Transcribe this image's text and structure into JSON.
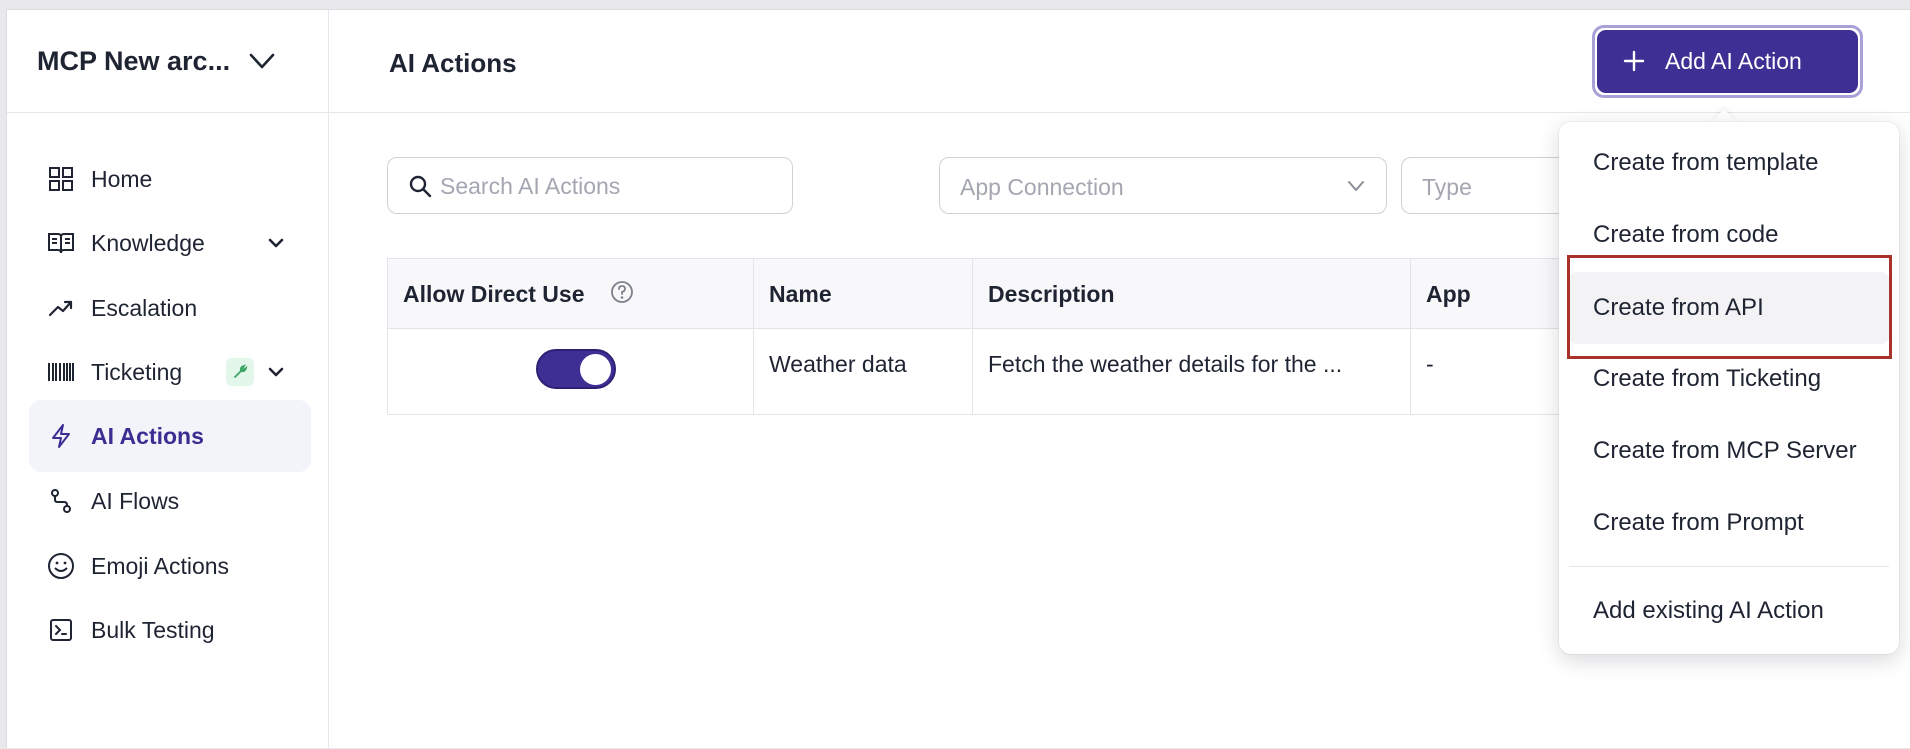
{
  "sidebar": {
    "workspace_name": "MCP New arc...",
    "items": [
      {
        "label": "Home",
        "icon": "grid-icon"
      },
      {
        "label": "Knowledge",
        "icon": "book-icon"
      },
      {
        "label": "Escalation",
        "icon": "trend-up-icon"
      },
      {
        "label": "Ticketing",
        "icon": "barcode-icon"
      },
      {
        "label": "AI Actions",
        "icon": "bolt-icon"
      },
      {
        "label": "AI Flows",
        "icon": "flow-icon"
      },
      {
        "label": "Emoji Actions",
        "icon": "smile-icon"
      },
      {
        "label": "Bulk Testing",
        "icon": "terminal-icon"
      }
    ],
    "active_item": "AI Actions"
  },
  "header": {
    "title": "AI Actions",
    "add_button_label": "Add AI Action"
  },
  "filters": {
    "search_placeholder": "Search AI Actions",
    "app_connection_placeholder": "App Connection",
    "type_placeholder": "Type"
  },
  "table": {
    "columns": [
      "Allow Direct Use",
      "Name",
      "Description",
      "App"
    ],
    "rows": [
      {
        "allow_direct_use": true,
        "name": "Weather data",
        "description": "Fetch the weather details for the ...",
        "app": "-"
      }
    ]
  },
  "menu": {
    "items": [
      "Create from template",
      "Create from code",
      "Create from API",
      "Create from Ticketing",
      "Create from MCP Server",
      "Create from Prompt"
    ],
    "footer_item": "Add existing AI Action",
    "highlighted": "Create from API"
  },
  "colors": {
    "accent": "#3d2f94",
    "highlight_border": "#a8322a"
  }
}
